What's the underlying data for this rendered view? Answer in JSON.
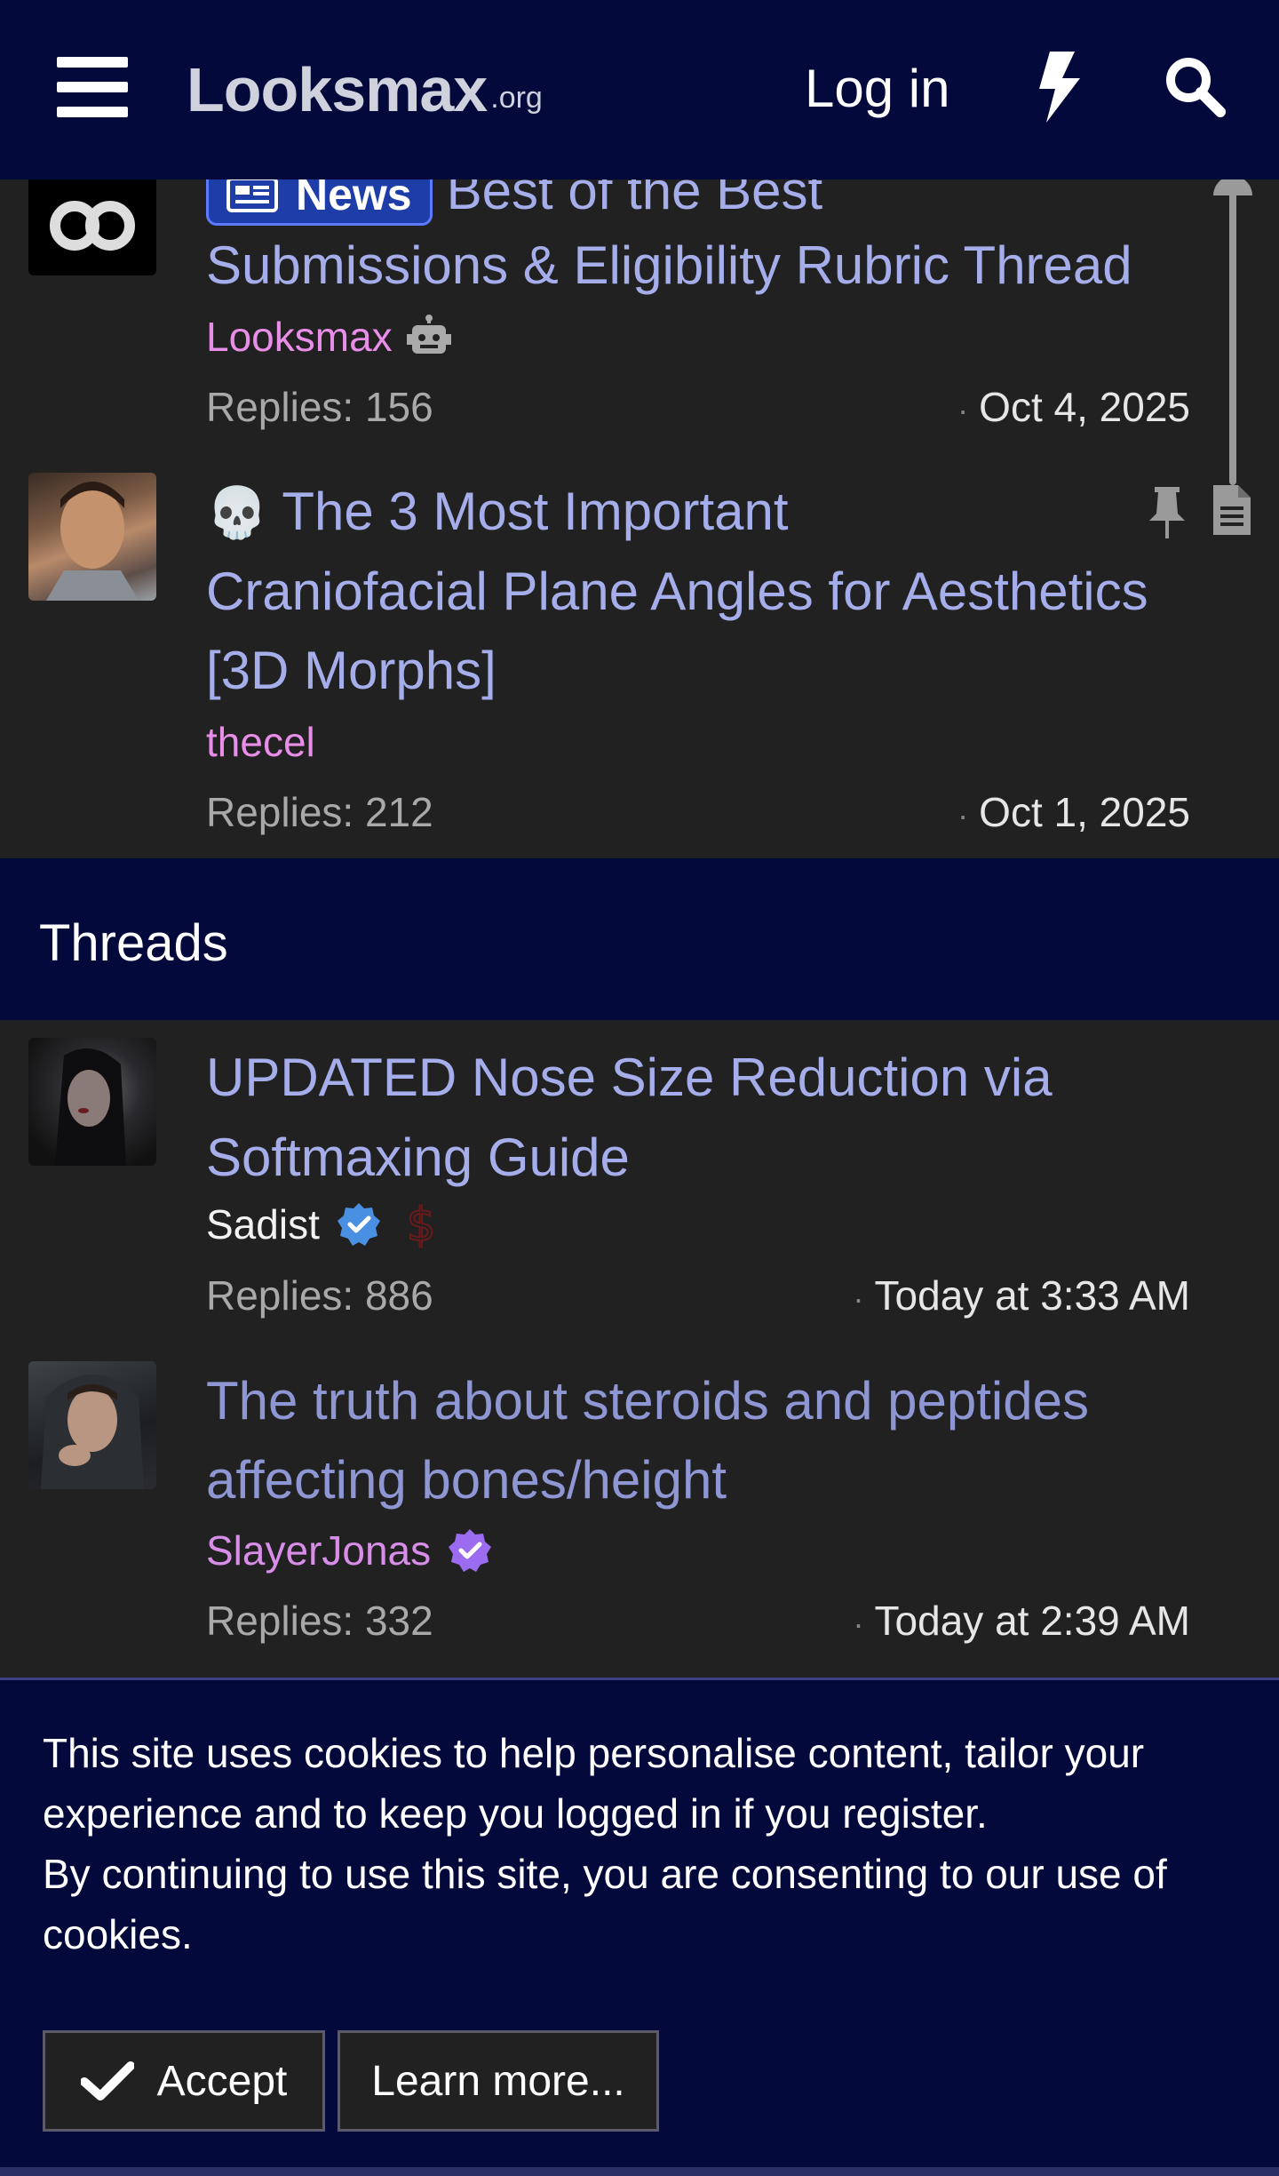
{
  "header": {
    "logo_main": "Looksmax",
    "logo_tld": ".org",
    "login_label": "Log in"
  },
  "sticky_threads": [
    {
      "badge": "News",
      "title_line1": "Best of the Best",
      "title_line2": "Submissions & Eligibility Rubric Thread",
      "author": "Looksmax",
      "replies": "Replies: 156",
      "date": "Oct 4, 2025"
    },
    {
      "title_emoji": "💀",
      "title_line1": "The 3 Most Important",
      "title_line2": "Craniofacial Plane Angles for Aesthetics",
      "title_line3": "[3D Morphs]",
      "author": "thecel",
      "replies": "Replies: 212",
      "date": "Oct 1, 2025"
    }
  ],
  "section": {
    "title": "Threads"
  },
  "threads": [
    {
      "title_line1": "UPDATED Nose Size Reduction via",
      "title_line2": "Softmaxing Guide",
      "author": "Sadist",
      "replies": "Replies: 886",
      "date": "Today at 3:33 AM"
    },
    {
      "title_line1": "The truth about steroids and peptides",
      "title_line2": "affecting bones/height",
      "author": "SlayerJonas",
      "replies": "Replies: 332",
      "date": "Today at 2:39 AM"
    }
  ],
  "cookie": {
    "line1": "This site uses cookies to help personalise content, tailor your experience and to keep you logged in if you register.",
    "line2": "By continuing to use this site, you are consenting to our use of cookies.",
    "accept_label": "Accept",
    "learn_label": "Learn more..."
  },
  "colors": {
    "header_bg": "#03093b",
    "body_bg": "#212121",
    "title_link": "#a5aeea",
    "author_pink": "#e88ee8",
    "author_purple": "#c88cf0",
    "verified_blue": "#4a90e2",
    "verified_purple": "#9b6cf0"
  },
  "icons": [
    "hamburger-icon",
    "bolt-icon",
    "search-icon",
    "robot-icon",
    "pin-icon",
    "document-icon",
    "verified-icon",
    "dollar-icon",
    "check-icon",
    "newspaper-icon"
  ]
}
